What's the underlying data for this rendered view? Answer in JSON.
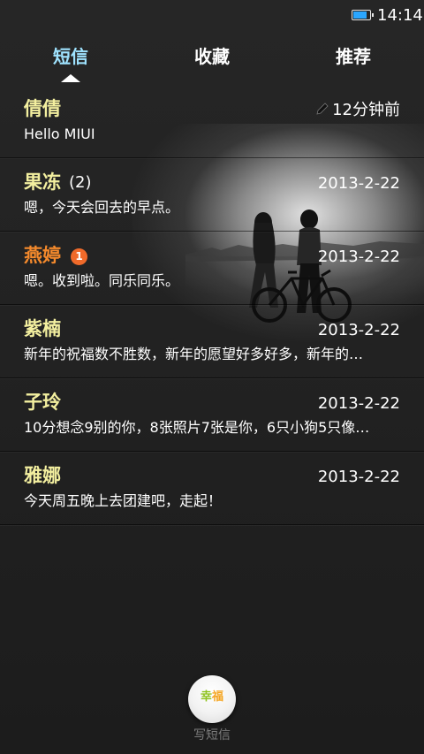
{
  "status_bar": {
    "time": "14:14",
    "battery_level": 0.9
  },
  "tabs": [
    {
      "label": "短信",
      "active": true
    },
    {
      "label": "收藏",
      "active": false
    },
    {
      "label": "推荐",
      "active": false
    }
  ],
  "conversations": [
    {
      "name": "倩倩",
      "count": "",
      "badge": "",
      "time": "12分钟前",
      "preview": "Hello MIUI",
      "draft": true,
      "unread": false
    },
    {
      "name": "果冻",
      "count": "(2)",
      "badge": "",
      "time": "2013-2-22",
      "preview": "嗯，今天会回去的早点。",
      "draft": false,
      "unread": false
    },
    {
      "name": "燕婷",
      "count": "",
      "badge": "1",
      "time": "2013-2-22",
      "preview": "嗯。收到啦。同乐同乐。",
      "draft": false,
      "unread": true
    },
    {
      "name": "紫楠",
      "count": "",
      "badge": "",
      "time": "2013-2-22",
      "preview": "新年的祝福数不胜数，新年的愿望好多好多，新年的…",
      "draft": false,
      "unread": false
    },
    {
      "name": "子玲",
      "count": "",
      "badge": "",
      "time": "2013-2-22",
      "preview": "10分想念9别的你，8张照片7张是你，6只小狗5只像…",
      "draft": false,
      "unread": false
    },
    {
      "name": "雅娜",
      "count": "",
      "badge": "",
      "time": "2013-2-22",
      "preview": "今天周五晚上去团建吧，走起！",
      "draft": false,
      "unread": false
    }
  ],
  "compose": {
    "icon_text_1": "幸",
    "icon_text_2": "福",
    "caption": "写短信"
  },
  "colors": {
    "name": "#f3ef9f",
    "unread_name": "#f58a2c",
    "active_tab": "#9fe3ff",
    "badge": "#f06a2a",
    "battery": "#2aa6ff"
  }
}
